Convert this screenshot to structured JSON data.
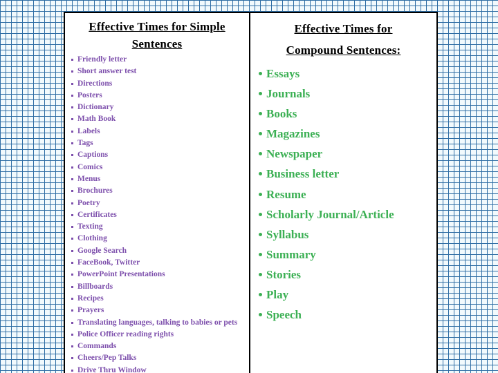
{
  "slide": {
    "left_column": {
      "title": "Effective Times for Simple Sentences",
      "bullet_style": "square",
      "text_color": "#7d4fac",
      "items": [
        "Friendly letter",
        "Short answer test",
        "Directions",
        "Posters",
        "Dictionary",
        "Math Book",
        "Labels",
        "Tags",
        "Captions",
        "Comics",
        "Menus",
        "Brochures",
        "Poetry",
        "Certificates",
        "Texting",
        "Clothing",
        "Google Search",
        "FaceBook, Twitter",
        "PowerPoint Presentations",
        "Billboards",
        "Recipes",
        "Prayers",
        "Translating languages, talking to babies or pets",
        "Police Officer reading rights",
        "Commands",
        "Cheers/Pep Talks",
        "Drive Thru Window"
      ]
    },
    "right_column": {
      "title": "Effective Times for Compound Sentences:",
      "title_line_1": "Effective Times for",
      "title_line_2": "Compound Sentences:",
      "bullet_style": "round",
      "text_color": "#3cb054",
      "items": [
        "Essays",
        "Journals",
        "Books",
        "Magazines",
        "Newspaper",
        "Business letter",
        "Resume",
        "Scholarly Journal/Article",
        "Syllabus",
        "Summary",
        "Stories",
        "Play",
        "Speech"
      ]
    },
    "background": {
      "pattern": "graph-paper-grid",
      "grid_color": "#2e6da4",
      "base_color": "#f2fafd"
    },
    "panel": {
      "background_color": "#ffffff",
      "border_color": "#000000"
    }
  }
}
